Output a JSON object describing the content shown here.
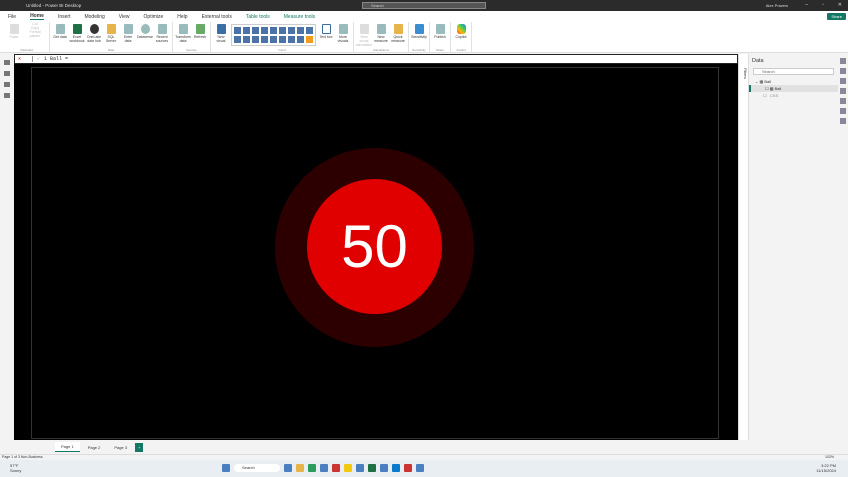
{
  "titlebar": {
    "title": "Untitled - Power BI Desktop",
    "search": "Search",
    "user": "Alex Powers",
    "min": "–",
    "restore": "▫",
    "close": "✕"
  },
  "menu": [
    "File",
    "Home",
    "Insert",
    "Modeling",
    "View",
    "Optimize",
    "Help",
    "External tools",
    "Table tools",
    "Measure tools"
  ],
  "share": "Share",
  "ribbon": {
    "clipboard": {
      "label": "Clipboard",
      "items": [
        "Paste",
        "Cut",
        "Copy",
        "Format painter"
      ]
    },
    "data": {
      "label": "Data",
      "items": [
        "Get data",
        "Excel workbook",
        "OneLake data hub",
        "SQL Server",
        "Enter data",
        "Dataverse",
        "Recent sources"
      ]
    },
    "queries": {
      "label": "Queries",
      "items": [
        "Transform data",
        "Refresh"
      ]
    },
    "insert": {
      "label": "Insert",
      "items": [
        "New visual",
        "Text box",
        "More visuals"
      ]
    },
    "calculations": {
      "label": "Calculations",
      "items": [
        "New visual calculation",
        "New measure",
        "Quick measure"
      ]
    },
    "sensitivity": {
      "label": "Sensitivity",
      "items": [
        "Sensitivity"
      ]
    },
    "share": {
      "label": "Share",
      "items": [
        "Publish"
      ]
    },
    "copilot": {
      "label": "Copilot",
      "items": [
        "Copilot"
      ]
    }
  },
  "formula": {
    "cancel": "✕",
    "commit": "✓",
    "text": "1 Ball ="
  },
  "visual": {
    "value": "50",
    "ball_color": "#e00000",
    "halo_color": "#2d0000"
  },
  "filters": "Filters",
  "data_pane": {
    "title": "Data",
    "search": "Search",
    "tree": [
      {
        "label": "Ball"
      },
      {
        "label": "Ball"
      },
      {
        "label": "CSS"
      }
    ]
  },
  "pages": [
    "Page 1",
    "Page 2",
    "Page 3"
  ],
  "add_page": "+",
  "status": {
    "left": "Page 1 of 3  Non-Business",
    "zoom": "102%"
  },
  "taskbar": {
    "temp": "57°F",
    "weather": "Sunny",
    "search": "Search",
    "time": "3:22 PM",
    "date": "11/15/2024"
  }
}
